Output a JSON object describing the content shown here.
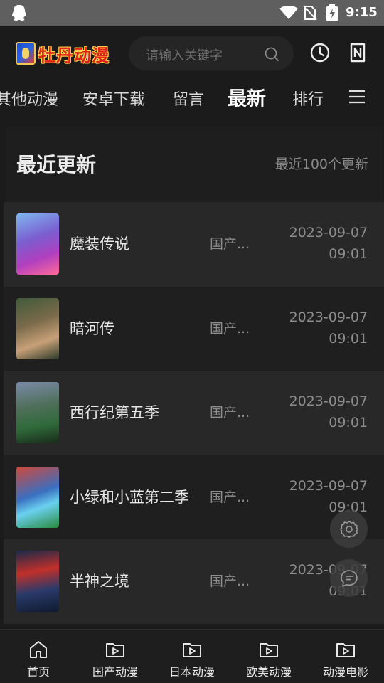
{
  "status_bar": {
    "time": "9:15"
  },
  "header": {
    "logo_text": "牡丹动漫",
    "search_placeholder": "请输入关键字"
  },
  "nav": {
    "tabs": [
      {
        "label": "其他动漫",
        "active": false
      },
      {
        "label": "安卓下载",
        "active": false
      },
      {
        "label": "留言",
        "active": false
      },
      {
        "label": "最新",
        "active": true
      },
      {
        "label": "排行",
        "active": false
      }
    ]
  },
  "section": {
    "title": "最近更新",
    "subtitle": "最近100个更新"
  },
  "list": [
    {
      "name": "魔装传说",
      "category": "国产...",
      "date": "2023-09-07",
      "time": "09:01"
    },
    {
      "name": "暗河传",
      "category": "国产...",
      "date": "2023-09-07",
      "time": "09:01"
    },
    {
      "name": "西行纪第五季",
      "category": "国产...",
      "date": "2023-09-07",
      "time": "09:01"
    },
    {
      "name": "小绿和小蓝第二季",
      "category": "国产...",
      "date": "2023-09-07",
      "time": "09:01"
    },
    {
      "name": "半神之境",
      "category": "国产...",
      "date": "2023-09-07",
      "time": "09:01"
    }
  ],
  "bottom_nav": [
    {
      "label": "首页",
      "icon": "home-icon"
    },
    {
      "label": "国产动漫",
      "icon": "video-folder-icon"
    },
    {
      "label": "日本动漫",
      "icon": "video-folder-icon"
    },
    {
      "label": "欧美动漫",
      "icon": "video-folder-icon"
    },
    {
      "label": "动漫电影",
      "icon": "video-folder-icon"
    }
  ],
  "colors": {
    "background": "#1b1b1b",
    "row_alt": "#282828",
    "logo_red": "#e0231b"
  }
}
